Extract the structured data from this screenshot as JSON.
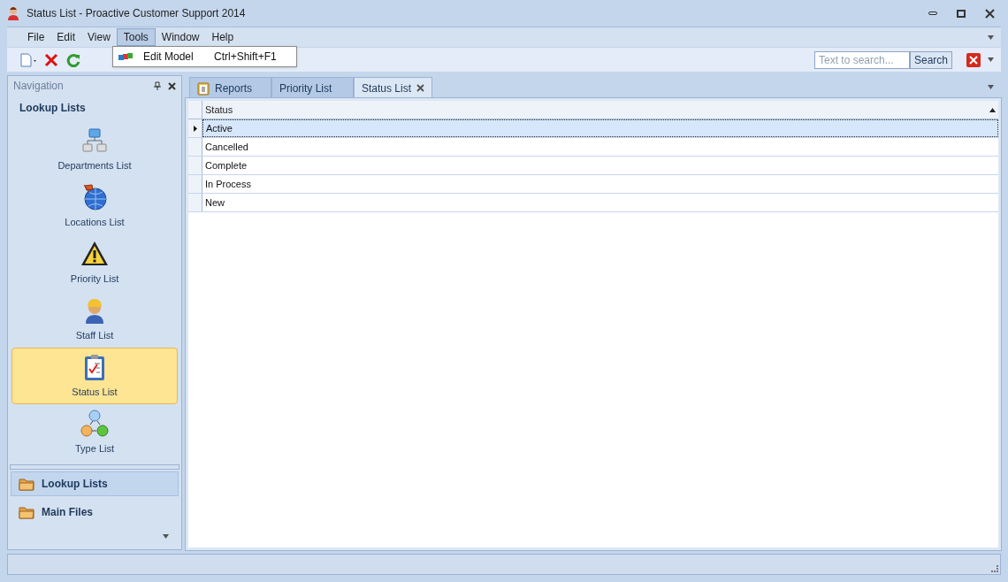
{
  "window": {
    "title": "Status List - Proactive Customer Support 2014"
  },
  "menu": [
    {
      "label": "File",
      "selected": false
    },
    {
      "label": "Edit",
      "selected": false
    },
    {
      "label": "View",
      "selected": false
    },
    {
      "label": "Tools",
      "selected": true
    },
    {
      "label": "Window",
      "selected": false
    },
    {
      "label": "Help",
      "selected": false
    }
  ],
  "dropdown": [
    {
      "label": "Edit Model",
      "shortcut": "Ctrl+Shift+F1"
    }
  ],
  "search": {
    "placeholder": "Text to search...",
    "button": "Search"
  },
  "navigation": {
    "title": "Navigation",
    "group_title": "Lookup Lists",
    "items": [
      {
        "label": "Departments List",
        "selected": false
      },
      {
        "label": "Locations List",
        "selected": false
      },
      {
        "label": "Priority List",
        "selected": false
      },
      {
        "label": "Staff List",
        "selected": false
      },
      {
        "label": "Status List",
        "selected": true
      },
      {
        "label": "Type List",
        "selected": false
      }
    ],
    "groups": [
      {
        "label": "Lookup Lists",
        "selected": true
      },
      {
        "label": "Main Files",
        "selected": false
      }
    ]
  },
  "tabs": [
    {
      "label": "Reports",
      "selected": false,
      "closable": false
    },
    {
      "label": "Priority List",
      "selected": false,
      "closable": false
    },
    {
      "label": "Status List",
      "selected": true,
      "closable": true
    }
  ],
  "table": {
    "columns": [
      "Status"
    ],
    "rows": [
      {
        "cells": [
          "Active"
        ],
        "selected": true
      },
      {
        "cells": [
          "Cancelled"
        ],
        "selected": false
      },
      {
        "cells": [
          "Complete"
        ],
        "selected": false
      },
      {
        "cells": [
          "In Process"
        ],
        "selected": false
      },
      {
        "cells": [
          "New"
        ],
        "selected": false
      }
    ]
  }
}
